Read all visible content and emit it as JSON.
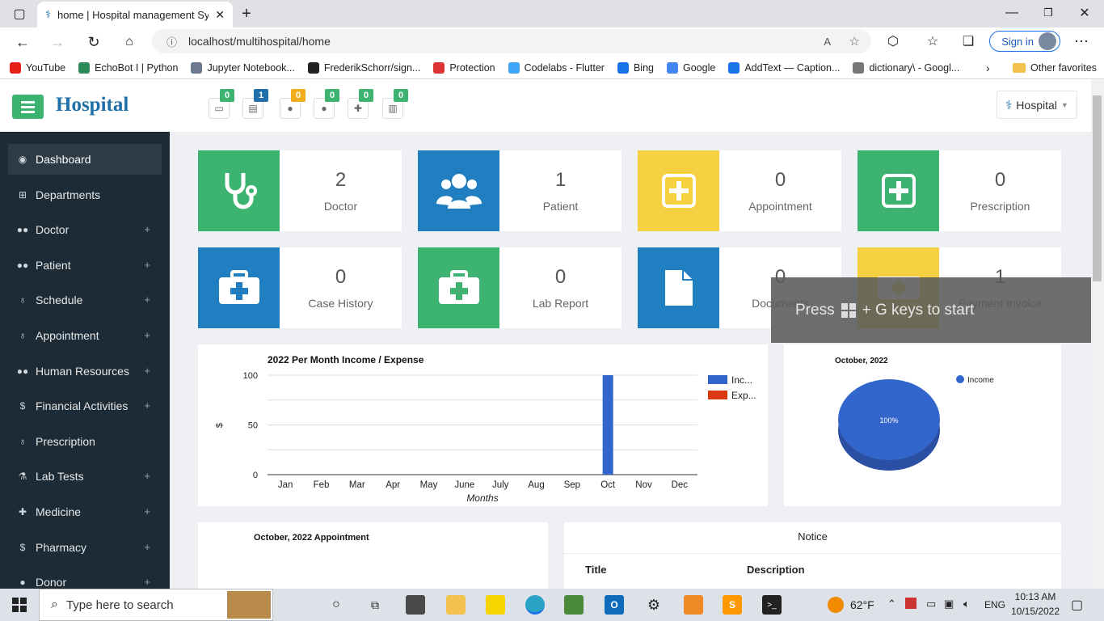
{
  "browser": {
    "tab_title": "home | Hospital management Sy",
    "url": "localhost/multihospital/home",
    "signin_label": "Sign in",
    "favorites": [
      {
        "label": "YouTube",
        "color": "#e62117"
      },
      {
        "label": "EchoBot I | Python",
        "color": "#2e8b57"
      },
      {
        "label": "Jupyter Notebook...",
        "color": "#6b7a8f"
      },
      {
        "label": "FrederikSchorr/sign...",
        "color": "#222222"
      },
      {
        "label": "Protection",
        "color": "#d33"
      },
      {
        "label": "Codelabs - Flutter",
        "color": "#42a5f5"
      },
      {
        "label": "Bing",
        "color": "#1a73e8"
      },
      {
        "label": "Google",
        "color": "#4285f4"
      },
      {
        "label": "AddText — Caption...",
        "color": "#1a73e8"
      },
      {
        "label": "dictionary\\ - Googl...",
        "color": "#777777"
      }
    ],
    "other_favorites": "Other favorites"
  },
  "header": {
    "brand": "Hospital",
    "badges": [
      "0",
      "1",
      "0",
      "0",
      "0",
      "0"
    ],
    "badge_colors": [
      "#3cb371",
      "#1f6fa8",
      "#f0ad1e",
      "#3cb371",
      "#3cb371",
      "#3cb371"
    ],
    "user_label": "Hospital"
  },
  "sidebar": {
    "items": [
      {
        "label": "Dashboard",
        "icon": "dashboard-icon",
        "plus": ""
      },
      {
        "label": "Departments",
        "icon": "sitemap-icon",
        "plus": ""
      },
      {
        "label": "Doctor",
        "icon": "users-icon",
        "plus": "+"
      },
      {
        "label": "Patient",
        "icon": "users-icon",
        "plus": "+"
      },
      {
        "label": "Schedule",
        "icon": "stethoscope-icon",
        "plus": "+"
      },
      {
        "label": "Appointment",
        "icon": "stethoscope-icon",
        "plus": "+"
      },
      {
        "label": "Human Resources",
        "icon": "users-icon",
        "plus": "+"
      },
      {
        "label": "Financial Activities",
        "icon": "dollar-icon",
        "plus": "+"
      },
      {
        "label": "Prescription",
        "icon": "stethoscope-icon",
        "plus": ""
      },
      {
        "label": "Lab Tests",
        "icon": "flask-icon",
        "plus": "+"
      },
      {
        "label": "Medicine",
        "icon": "medkit-icon",
        "plus": "+"
      },
      {
        "label": "Pharmacy",
        "icon": "dollar-icon",
        "plus": "+"
      },
      {
        "label": "Donor",
        "icon": "user-icon",
        "plus": "+"
      }
    ]
  },
  "cards": [
    {
      "num": "2",
      "label": "Doctor",
      "color": "#3cb371",
      "icon": "stethoscope-icon"
    },
    {
      "num": "1",
      "label": "Patient",
      "color": "#1f7fc0",
      "icon": "users-icon"
    },
    {
      "num": "0",
      "label": "Appointment",
      "color": "#f5d142",
      "icon": "plus-square-icon"
    },
    {
      "num": "0",
      "label": "Prescription",
      "color": "#3cb371",
      "icon": "plus-square-icon"
    },
    {
      "num": "0",
      "label": "Case History",
      "color": "#1f7fc0",
      "icon": "medkit-icon"
    },
    {
      "num": "0",
      "label": "Lab Report",
      "color": "#3cb371",
      "icon": "medkit-icon"
    },
    {
      "num": "0",
      "label": "Documents",
      "color": "#1f7fc0",
      "icon": "file-icon"
    },
    {
      "num": "1",
      "label": "Payment Invoice",
      "color": "#f5d142",
      "icon": "money-icon"
    }
  ],
  "toast": {
    "press": "Press",
    "rest": "+ G keys to start"
  },
  "chart_data": [
    {
      "type": "bar",
      "title": "2022 Per Month Income / Expense",
      "xlabel": "Months",
      "ylabel": "$",
      "ylim": [
        0,
        100
      ],
      "yticks": [
        "100",
        "50",
        "0"
      ],
      "categories": [
        "Jan",
        "Feb",
        "Mar",
        "Apr",
        "May",
        "June",
        "July",
        "Aug",
        "Sep",
        "Oct",
        "Nov",
        "Dec"
      ],
      "series": [
        {
          "name": "Inc...",
          "color": "#3366cc",
          "values": [
            0,
            0,
            0,
            0,
            0,
            0,
            0,
            0,
            0,
            100,
            0,
            0
          ]
        },
        {
          "name": "Exp...",
          "color": "#dc3912",
          "values": [
            0,
            0,
            0,
            0,
            0,
            0,
            0,
            0,
            0,
            0,
            0,
            0
          ]
        }
      ],
      "legend": "right"
    },
    {
      "type": "pie",
      "title": "October, 2022",
      "slices": [
        {
          "name": "Income",
          "value": 100,
          "label": "100%",
          "color": "#3366cc"
        }
      ],
      "legend": "top-right"
    }
  ],
  "appointment_panel": {
    "title": "October, 2022 Appointment"
  },
  "notice_panel": {
    "title": "Notice",
    "col_title": "Title",
    "col_description": "Description"
  },
  "taskbar": {
    "search_placeholder": "Type here to search",
    "weather": "62°F",
    "lang": "ENG",
    "time": "10:13 AM",
    "date": "10/15/2022"
  }
}
